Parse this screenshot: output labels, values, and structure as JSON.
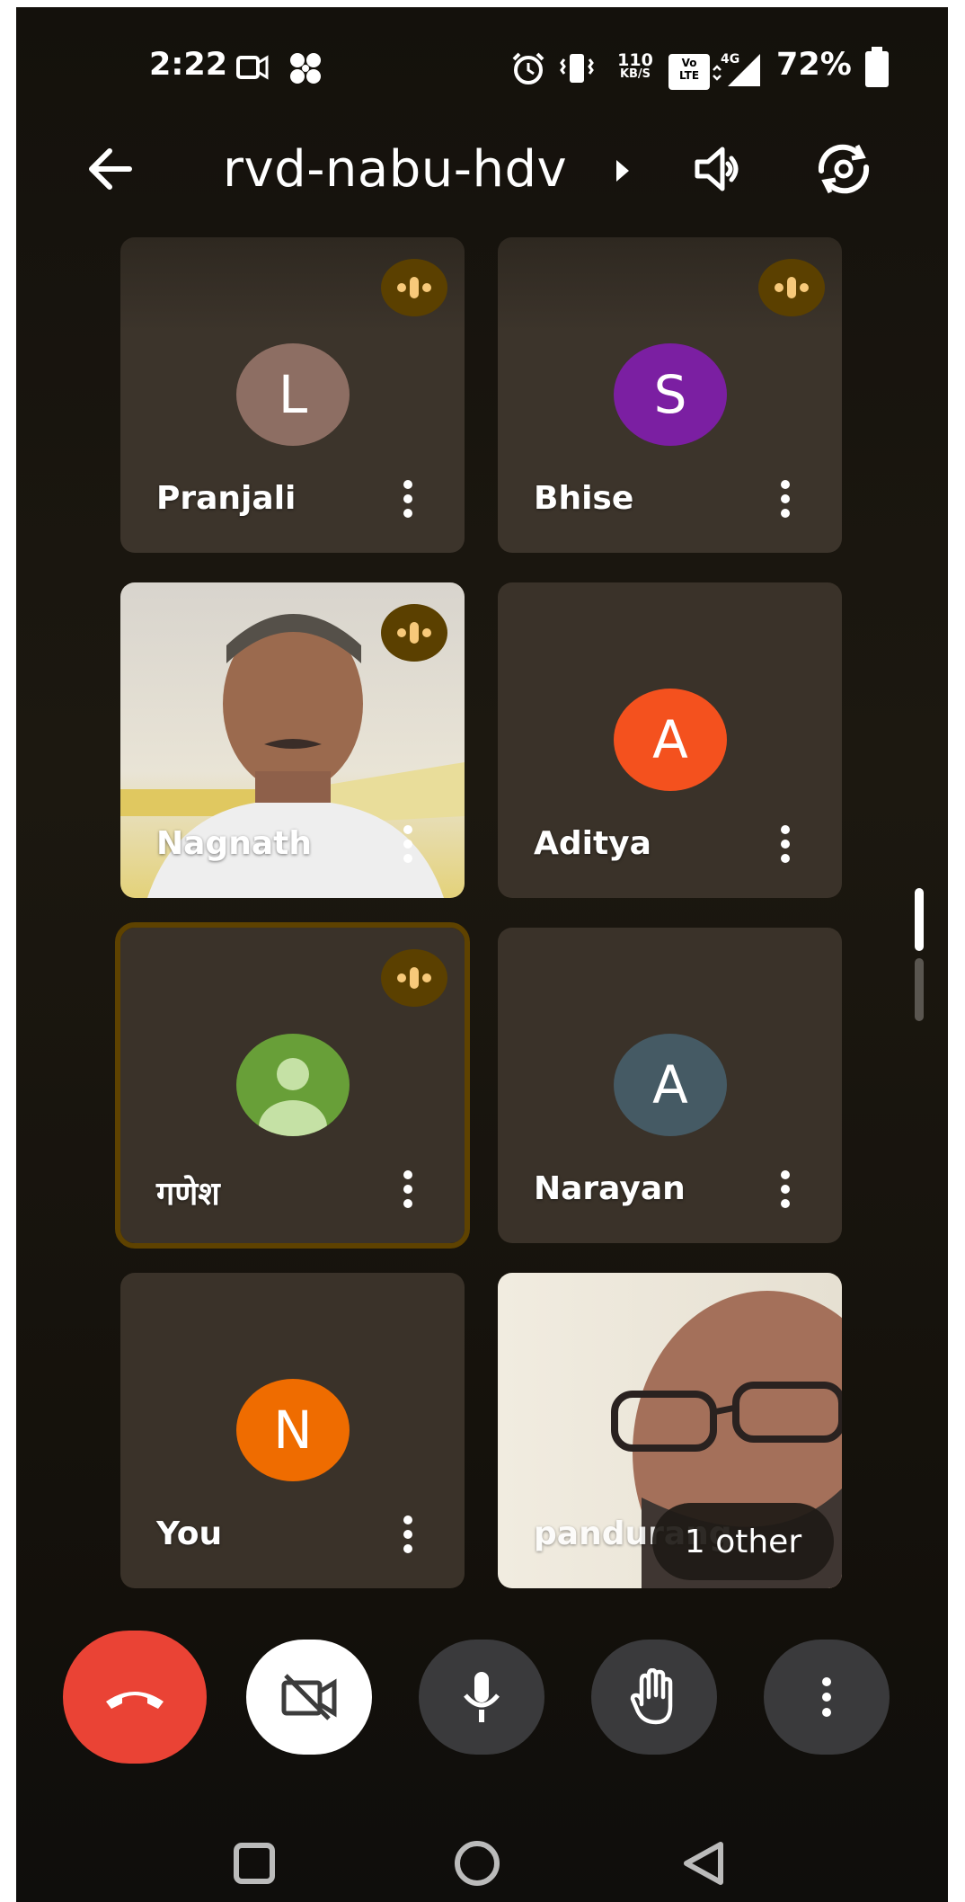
{
  "status_bar": {
    "time": "2:22",
    "network_speed_top": "110",
    "network_speed_bottom": "KB/S",
    "volte_top": "Vo",
    "volte_bottom": "LTE",
    "network_type": "4G",
    "battery": "72%"
  },
  "header": {
    "title": "rvd-nabu-hdv"
  },
  "participants": [
    {
      "name": "Pranjali",
      "initial": "L",
      "avatar_color": "#8d6e63",
      "speaking": true,
      "video": false
    },
    {
      "name": "Bhise",
      "initial": "S",
      "avatar_color": "#7b1fa2",
      "speaking": true,
      "video": false
    },
    {
      "name": "Nagnath",
      "initial": "",
      "avatar_color": "",
      "speaking": true,
      "video": true
    },
    {
      "name": "Aditya",
      "initial": "A",
      "avatar_color": "#f4511e",
      "speaking": false,
      "video": false
    },
    {
      "name": "गणेश",
      "initial": "",
      "avatar_color": "#689f38",
      "speaking": true,
      "video": false,
      "active_speaker": true
    },
    {
      "name": "Narayan",
      "initial": "A",
      "avatar_color": "#455a64",
      "speaking": false,
      "video": false
    },
    {
      "name": "You",
      "initial": "N",
      "avatar_color": "#ef6c00",
      "speaking": false,
      "video": false
    },
    {
      "name": "pandurang",
      "initial": "",
      "avatar_color": "",
      "speaking": false,
      "video": true
    }
  ],
  "overflow": {
    "label": "1 other"
  },
  "controls": {
    "end_call_color": "#ea4335",
    "camera_button_color": "#ffffff",
    "control_button_color": "#3a3a3c",
    "speaking_badge_color": "#5b4000",
    "speaking_dots_color": "#f7c97a"
  },
  "icons": [
    "back-arrow-icon",
    "chevron-right-icon",
    "speaker-icon",
    "switch-camera-icon",
    "speaking-indicator-icon",
    "more-vert-icon",
    "end-call-icon",
    "camera-off-icon",
    "mic-icon",
    "raise-hand-icon",
    "nav-recents-icon",
    "nav-home-icon",
    "nav-back-icon"
  ]
}
